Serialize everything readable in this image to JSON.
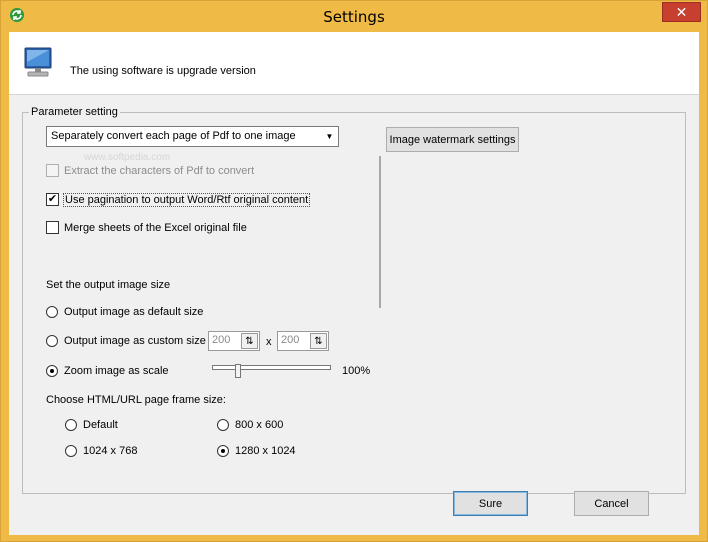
{
  "window": {
    "title": "Settings",
    "close_glyph": "✕",
    "icon": "app-refresh-icon"
  },
  "header": {
    "icon": "monitor-icon",
    "message": "The using software is upgrade version"
  },
  "parameter_group": {
    "legend": "Parameter setting",
    "convert_mode": {
      "selected": "Separately convert each page of Pdf to one image",
      "arrow": "▼"
    },
    "image_watermark_button": "Image watermark settings",
    "watermark_ghost": "www.softpedia.com",
    "extract_chars": {
      "label": "Extract the characters of Pdf to convert",
      "checked": false,
      "disabled": true
    },
    "use_pagination": {
      "label": "Use pagination to output Word/Rtf original content",
      "checked": true
    },
    "merge_sheets": {
      "label": "Merge sheets of the Excel original file",
      "checked": false
    },
    "output_size_heading": "Set the output image size",
    "default_size": {
      "label": "Output image as default size",
      "selected": false
    },
    "custom_size": {
      "label": "Output image as custom size",
      "selected": false,
      "width_value": "200",
      "height_value": "200",
      "separator": "x"
    },
    "zoom": {
      "label": "Zoom image as scale",
      "selected": true,
      "value_text": "100%",
      "slider_fraction": 0.2
    },
    "frame_heading": "Choose HTML/URL page frame size:",
    "frame_options": [
      {
        "label": "Default",
        "selected": false
      },
      {
        "label": "800 x 600",
        "selected": false
      },
      {
        "label": "1024 x 768",
        "selected": false
      },
      {
        "label": "1280 x 1024",
        "selected": true
      }
    ]
  },
  "footer": {
    "ok_label": "Sure",
    "cancel_label": "Cancel"
  },
  "colors": {
    "title_bar": "#f0ba46",
    "close_button": "#c7402f",
    "dialog_bg": "#f0f0f0"
  }
}
